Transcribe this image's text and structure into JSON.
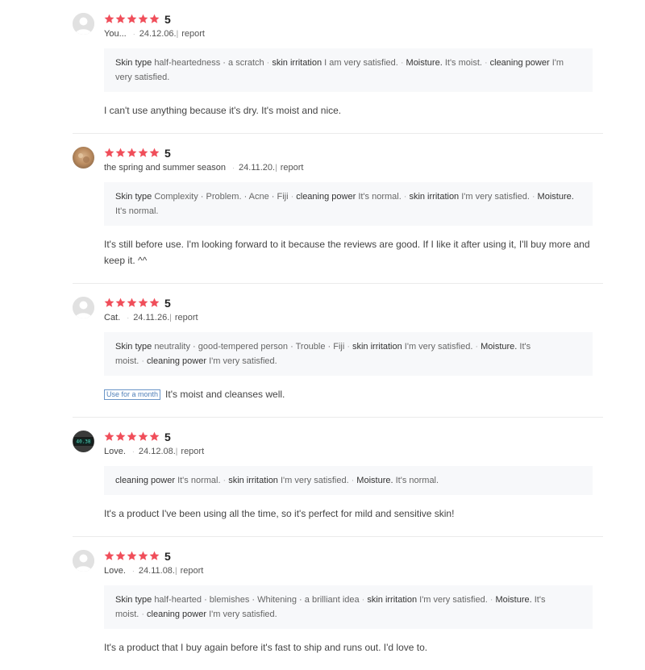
{
  "star_color": "#f04e5a",
  "reviews": [
    {
      "avatar": "default-avatar",
      "rating": 5,
      "score_label": "5",
      "author": "You...",
      "date": "24.12.06.",
      "report_label": "report",
      "attributes_text": "Skin type half-heartedness · a scratch · skin irritation I am very satisfied. · Moisture. It's moist. · cleaning power I'm very satisfied.",
      "attributes": [
        {
          "key": "Skin type",
          "value": "half-heartedness · a scratch"
        },
        {
          "key": "skin irritation",
          "value": "I am very satisfied."
        },
        {
          "key": "Moisture.",
          "value": "It's moist."
        },
        {
          "key": "cleaning power",
          "value": "I'm very satisfied."
        }
      ],
      "tag": "",
      "text": "I can't use anything because it's dry. It's moist and nice."
    },
    {
      "avatar": "photo-avatar-brown",
      "rating": 5,
      "score_label": "5",
      "author": "the spring and summer season",
      "date": "24.11.20.",
      "report_label": "report",
      "attributes": [
        {
          "key": "Skin type",
          "value": "Complexity · Problem. · Acne · Fiji"
        },
        {
          "key": "cleaning power",
          "value": "It's normal."
        },
        {
          "key": "skin irritation",
          "value": "I'm very satisfied."
        },
        {
          "key": "Moisture.",
          "value": "It's normal."
        }
      ],
      "tag": "",
      "text": "It's still before use. I'm looking forward to it because the reviews are good. If I like it after using it, I'll buy more and keep it. ^^"
    },
    {
      "avatar": "default-avatar",
      "rating": 5,
      "score_label": "5",
      "author": "Cat.",
      "date": "24.11.26.",
      "report_label": "report",
      "attributes": [
        {
          "key": "Skin type",
          "value": "neutrality · good-tempered person · Trouble · Fiji"
        },
        {
          "key": "skin irritation",
          "value": "I'm very satisfied."
        },
        {
          "key": "Moisture.",
          "value": "It's moist."
        },
        {
          "key": "cleaning power",
          "value": "I'm very satisfied."
        }
      ],
      "tag": "Use for a month",
      "text": "It's moist and cleanses well."
    },
    {
      "avatar": "photo-avatar-device",
      "rating": 5,
      "score_label": "5",
      "author": "Love.",
      "date": "24.12.08.",
      "report_label": "report",
      "attributes": [
        {
          "key": "cleaning power",
          "value": "It's normal."
        },
        {
          "key": "skin irritation",
          "value": "I'm very satisfied."
        },
        {
          "key": "Moisture.",
          "value": "It's normal."
        }
      ],
      "tag": "",
      "text": "It's a product I've been using all the time, so it's perfect for mild and sensitive skin!"
    },
    {
      "avatar": "default-avatar",
      "rating": 5,
      "score_label": "5",
      "author": "Love.",
      "date": "24.11.08.",
      "report_label": "report",
      "attributes": [
        {
          "key": "Skin type",
          "value": "half-hearted · blemishes · Whitening · a brilliant idea"
        },
        {
          "key": "skin irritation",
          "value": "I'm very satisfied."
        },
        {
          "key": "Moisture.",
          "value": "It's moist."
        },
        {
          "key": "cleaning power",
          "value": "I'm very satisfied."
        }
      ],
      "tag": "",
      "text": "It's a product that I buy again before it's fast to ship and runs out. I'd love to."
    }
  ]
}
